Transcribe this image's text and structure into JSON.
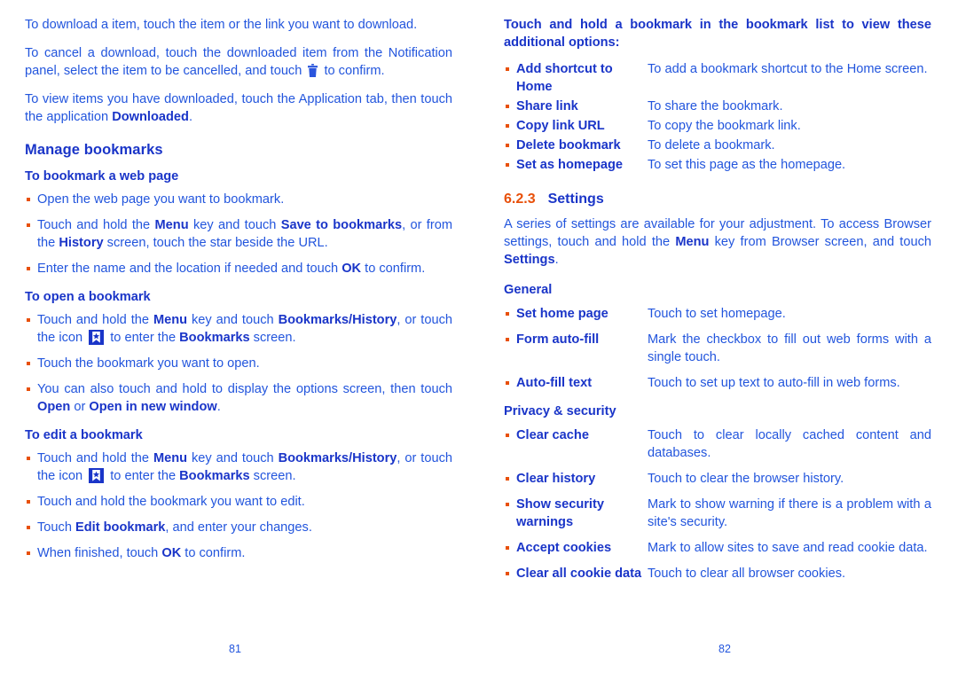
{
  "colors": {
    "body_blue": "#2255dd",
    "heading_blue": "#1a35c8",
    "bullet_orange": "#e8500a",
    "page_bg": "#ffffff"
  },
  "left_page": {
    "page_number": "81",
    "paragraphs": [
      {
        "id": "download-item",
        "parts": [
          {
            "text": "To download a item, touch the item or the link you want to download.",
            "bold": false
          }
        ]
      },
      {
        "id": "cancel-download",
        "parts": [
          {
            "text": "To cancel a download, touch the downloaded item from the Notification panel, select the item to be cancelled, and touch ",
            "bold": false
          },
          {
            "icon": "trash-icon"
          },
          {
            "text": " to confirm.",
            "bold": false
          }
        ]
      },
      {
        "id": "view-downloaded",
        "parts": [
          {
            "text": "To view items you have downloaded, touch the Application tab, then touch the application ",
            "bold": false
          },
          {
            "text": "Downloaded",
            "bold": true
          },
          {
            "text": ".",
            "bold": false
          }
        ]
      }
    ],
    "section_title": "Manage bookmarks",
    "subsections": [
      {
        "id": "to-bookmark-a-web-page",
        "title": "To bookmark a web page",
        "bullets": [
          [
            {
              "text": "Open the web page you want to bookmark.",
              "bold": false
            }
          ],
          [
            {
              "text": "Touch and hold the ",
              "bold": false
            },
            {
              "text": "Menu",
              "bold": true
            },
            {
              "text": " key and touch ",
              "bold": false
            },
            {
              "text": "Save to bookmarks",
              "bold": true
            },
            {
              "text": ", or from the ",
              "bold": false
            },
            {
              "text": "History",
              "bold": true
            },
            {
              "text": " screen, touch the star beside the URL.",
              "bold": false
            }
          ],
          [
            {
              "text": "Enter the name and the location if needed and touch ",
              "bold": false
            },
            {
              "text": "OK",
              "bold": true
            },
            {
              "text": " to confirm.",
              "bold": false
            }
          ]
        ]
      },
      {
        "id": "to-open-a-bookmark",
        "title": "To open a bookmark",
        "bullets": [
          [
            {
              "text": "Touch and hold the ",
              "bold": false
            },
            {
              "text": "Menu",
              "bold": true
            },
            {
              "text": " key and touch ",
              "bold": false
            },
            {
              "text": "Bookmarks/History",
              "bold": true
            },
            {
              "text": ", or touch the icon ",
              "bold": false
            },
            {
              "icon": "bookmark-star-icon"
            },
            {
              "text": " to enter the ",
              "bold": false
            },
            {
              "text": "Bookmarks",
              "bold": true
            },
            {
              "text": " screen.",
              "bold": false
            }
          ],
          [
            {
              "text": "Touch the bookmark you want to open.",
              "bold": false
            }
          ],
          [
            {
              "text": "You can also touch and hold to display the options screen, then touch ",
              "bold": false
            },
            {
              "text": "Open",
              "bold": true
            },
            {
              "text": " or ",
              "bold": false
            },
            {
              "text": "Open in new window",
              "bold": true
            },
            {
              "text": ".",
              "bold": false
            }
          ]
        ]
      },
      {
        "id": "to-edit-a-bookmark",
        "title": "To edit a bookmark",
        "bullets": [
          [
            {
              "text": "Touch and hold the ",
              "bold": false
            },
            {
              "text": "Menu",
              "bold": true
            },
            {
              "text": " key and touch ",
              "bold": false
            },
            {
              "text": "Bookmarks/History",
              "bold": true
            },
            {
              "text": ", or touch the icon ",
              "bold": false
            },
            {
              "icon": "bookmark-star-icon"
            },
            {
              "text": " to enter the ",
              "bold": false
            },
            {
              "text": "Bookmarks",
              "bold": true
            },
            {
              "text": " screen.",
              "bold": false
            }
          ],
          [
            {
              "text": "Touch and hold the bookmark you want to edit.",
              "bold": false
            }
          ],
          [
            {
              "text": "Touch ",
              "bold": false
            },
            {
              "text": "Edit bookmark",
              "bold": true
            },
            {
              "text": ", and enter your changes.",
              "bold": false
            }
          ],
          [
            {
              "text": "When finished, touch ",
              "bold": false
            },
            {
              "text": "OK",
              "bold": true
            },
            {
              "text": " to confirm.",
              "bold": false
            }
          ]
        ]
      }
    ]
  },
  "right_page": {
    "page_number": "82",
    "intro_heading": "Touch and hold a bookmark in the bookmark list to view these additional options:",
    "options": [
      {
        "term": "Add shortcut to Home",
        "desc": "To add a bookmark shortcut to the Home screen."
      },
      {
        "term": "Share link",
        "desc": "To share the bookmark."
      },
      {
        "term": "Copy link URL",
        "desc": "To copy the bookmark link."
      },
      {
        "term": "Delete bookmark",
        "desc": "To delete a bookmark."
      },
      {
        "term": "Set as homepage",
        "desc": "To set this page as the homepage."
      }
    ],
    "settings_section": {
      "number": "6.2.3",
      "title": "Settings",
      "intro": [
        {
          "text": "A series of settings are available for your adjustment. To access Browser settings, touch and hold the ",
          "bold": false
        },
        {
          "text": "Menu",
          "bold": true
        },
        {
          "text": " key from Browser screen, and touch ",
          "bold": false
        },
        {
          "text": "Settings",
          "bold": true
        },
        {
          "text": ".",
          "bold": false
        }
      ],
      "groups": [
        {
          "id": "general",
          "title": "General",
          "items": [
            {
              "term": "Set home page",
              "desc": "Touch to set homepage."
            },
            {
              "term": "Form auto-fill",
              "desc": "Mark the checkbox to fill out web forms with a single touch."
            },
            {
              "term": "Auto-fill text",
              "desc": "Touch to set up text to auto-fill in web forms."
            }
          ]
        },
        {
          "id": "privacy-security",
          "title": "Privacy & security",
          "items": [
            {
              "term": "Clear cache",
              "desc": "Touch to clear locally cached content and databases."
            },
            {
              "term": "Clear history",
              "desc": "Touch to clear the browser history."
            },
            {
              "term": "Show security warnings",
              "desc": "Mark to show warning if there is a problem with a site's security."
            },
            {
              "term": "Accept cookies",
              "desc": "Mark to allow sites to save and read cookie data."
            },
            {
              "term": "Clear all cookie data",
              "desc": "Touch to clear all browser cookies."
            }
          ]
        }
      ]
    }
  }
}
